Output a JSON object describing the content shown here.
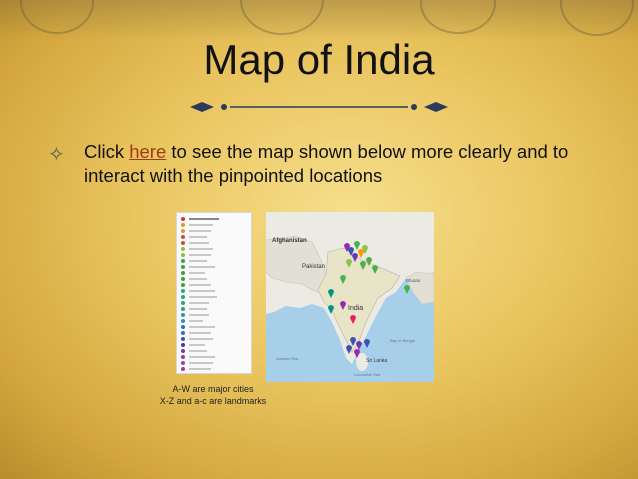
{
  "slide": {
    "title": "Map of India",
    "bullet": {
      "icon": "four-point-star-icon",
      "text_before": "Click ",
      "link_text": "here",
      "text_after": " to see the map shown below more clearly and to interact with the pinpointed locations"
    },
    "captions": [
      "A-W are major cities",
      "X-Z and a-c are landmarks"
    ]
  },
  "map": {
    "labels": {
      "afghanistan": "Afghanistan",
      "pakistan": "Pakistan",
      "india": "India",
      "bhutan": "Bhutan",
      "sri_lanka": "Sri Lanka",
      "arabian_sea": "Arabian Sea",
      "bay_of_bengal": "Bay of Bengal",
      "laccadive_sea": "Laccadive Sea"
    }
  },
  "colors": {
    "link": "#9d3c1b",
    "land": "#ecebe3",
    "water": "#a8cfe9"
  }
}
